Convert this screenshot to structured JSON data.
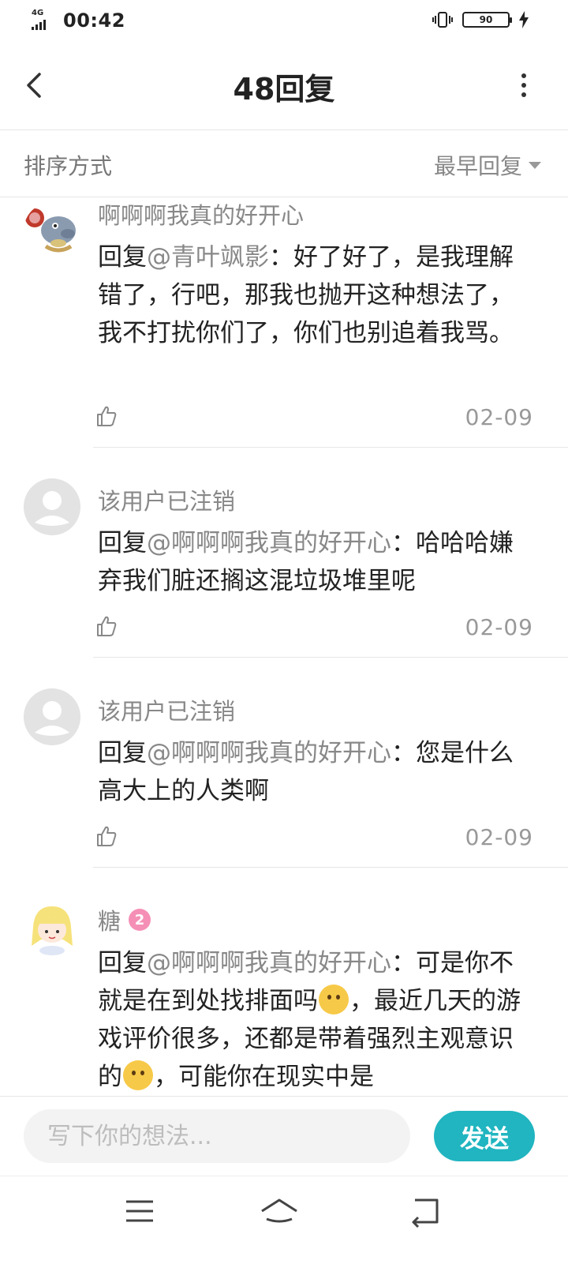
{
  "status_bar": {
    "network": "4G",
    "time": "00:42",
    "battery": "90"
  },
  "header": {
    "title": "48回复"
  },
  "sort": {
    "label": "排序方式",
    "value": "最早回复"
  },
  "replies": [
    {
      "username": "啊啊啊我真的好开心",
      "reply_prefix": "回复",
      "mention": "@青叶飒影",
      "separator": "：",
      "text": "好了好了，是我理解错了，行吧，那我也抛开这种想法了，我不打扰你们了，你们也别追着我骂。",
      "date": "02-09"
    },
    {
      "username": "该用户已注销",
      "reply_prefix": "回复",
      "mention": "@啊啊啊我真的好开心",
      "separator": "：",
      "text": "哈哈哈嫌弃我们脏还搁这混垃圾堆里呢",
      "date": "02-09"
    },
    {
      "username": "该用户已注销",
      "reply_prefix": "回复",
      "mention": "@啊啊啊我真的好开心",
      "separator": "：",
      "text": "您是什么高大上的人类啊",
      "date": "02-09"
    },
    {
      "username": "糖",
      "level": "2",
      "reply_prefix": "回复",
      "mention": "@啊啊啊我真的好开心",
      "separator": "：",
      "text_a": "可是你不就是在到处找排面吗",
      "text_b": "，最近几天的游戏评价很多，还都是带着强烈主观意识的",
      "text_c": "，可能你在现实中是"
    }
  ],
  "input": {
    "placeholder": "写下你的想法..."
  },
  "send_label": "发送",
  "colors": {
    "accent": "#20b5c0",
    "mention": "#888888",
    "level_badge": "#f58fb5"
  }
}
